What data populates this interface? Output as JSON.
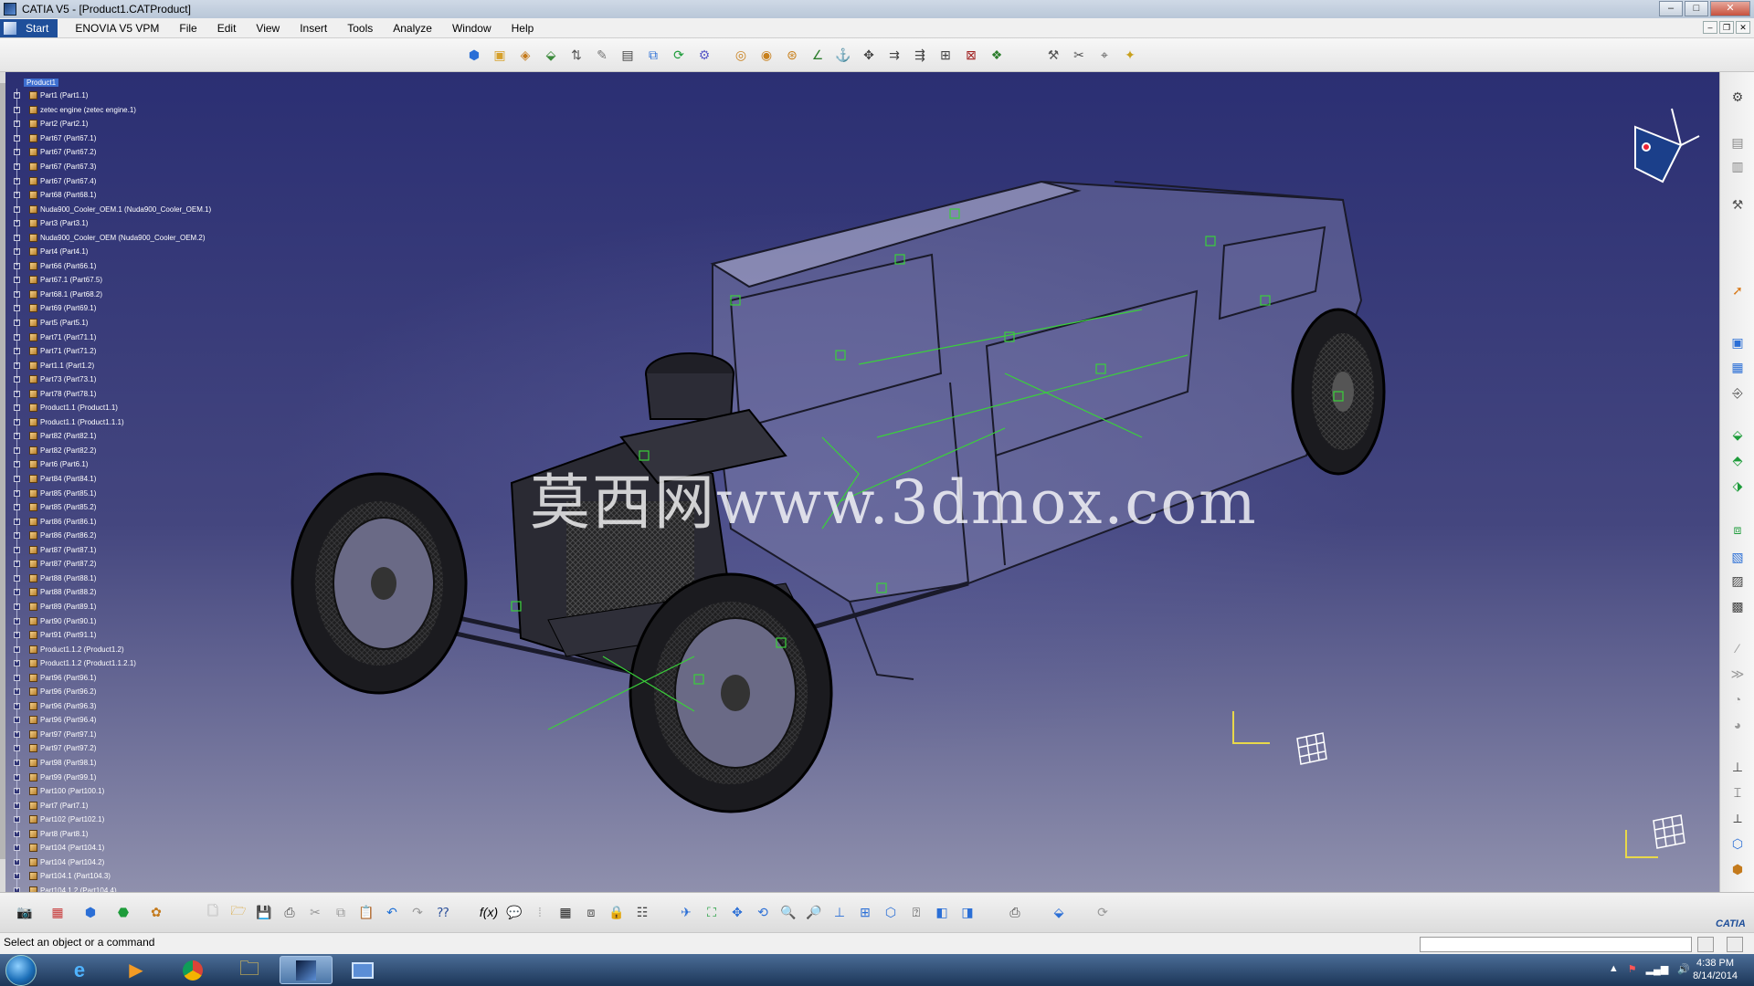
{
  "window": {
    "title": "CATIA V5 - [Product1.CATProduct]"
  },
  "menu": {
    "start": "Start",
    "items": [
      "ENOVIA V5 VPM",
      "File",
      "Edit",
      "View",
      "Insert",
      "Tools",
      "Analyze",
      "Window",
      "Help"
    ]
  },
  "tree": {
    "root": "Product1",
    "items": [
      "Part1 (Part1.1)",
      "zetec engine (zetec engine.1)",
      "Part2 (Part2.1)",
      "Part67 (Part67.1)",
      "Part67 (Part67.2)",
      "Part67 (Part67.3)",
      "Part67 (Part67.4)",
      "Part68 (Part68.1)",
      "Nuda900_Cooler_OEM.1 (Nuda900_Cooler_OEM.1)",
      "Part3 (Part3.1)",
      "Nuda900_Cooler_OEM (Nuda900_Cooler_OEM.2)",
      "Part4 (Part4.1)",
      "Part66 (Part66.1)",
      "Part67.1 (Part67.5)",
      "Part68.1 (Part68.2)",
      "Part69 (Part69.1)",
      "Part5 (Part5.1)",
      "Part71 (Part71.1)",
      "Part71 (Part71.2)",
      "Part1.1 (Part1.2)",
      "Part73 (Part73.1)",
      "Part78 (Part78.1)",
      "Product1.1 (Product1.1)",
      "Product1.1 (Product1.1.1)",
      "Part82 (Part82.1)",
      "Part82 (Part82.2)",
      "Part6 (Part6.1)",
      "Part84 (Part84.1)",
      "Part85 (Part85.1)",
      "Part85 (Part85.2)",
      "Part86 (Part86.1)",
      "Part86 (Part86.2)",
      "Part87 (Part87.1)",
      "Part87 (Part87.2)",
      "Part88 (Part88.1)",
      "Part88 (Part88.2)",
      "Part89 (Part89.1)",
      "Part90 (Part90.1)",
      "Part91 (Part91.1)",
      "Product1.1.2 (Product1.2)",
      "Product1.1.2 (Product1.1.2.1)",
      "Part96 (Part96.1)",
      "Part96 (Part96.2)",
      "Part96 (Part96.3)",
      "Part96 (Part96.4)",
      "Part97 (Part97.1)",
      "Part97 (Part97.2)",
      "Part98 (Part98.1)",
      "Part99 (Part99.1)",
      "Part100 (Part100.1)",
      "Part7 (Part7.1)",
      "Part102 (Part102.1)",
      "Part8 (Part8.1)",
      "Part104 (Part104.1)",
      "Part104 (Part104.2)",
      "Part104.1 (Part104.3)",
      "Part104.1.2 (Part104.4)"
    ]
  },
  "viewport": {
    "watermark": "莫西网www.3dmox.com"
  },
  "status": {
    "text": "Select an object or a command"
  },
  "taskbar": {
    "time": "4:38 PM",
    "date": "8/14/2014"
  },
  "colors": {
    "accent": "#1f4f9a",
    "selection": "#3e6fd1",
    "wireframe": "#3ad13a"
  }
}
